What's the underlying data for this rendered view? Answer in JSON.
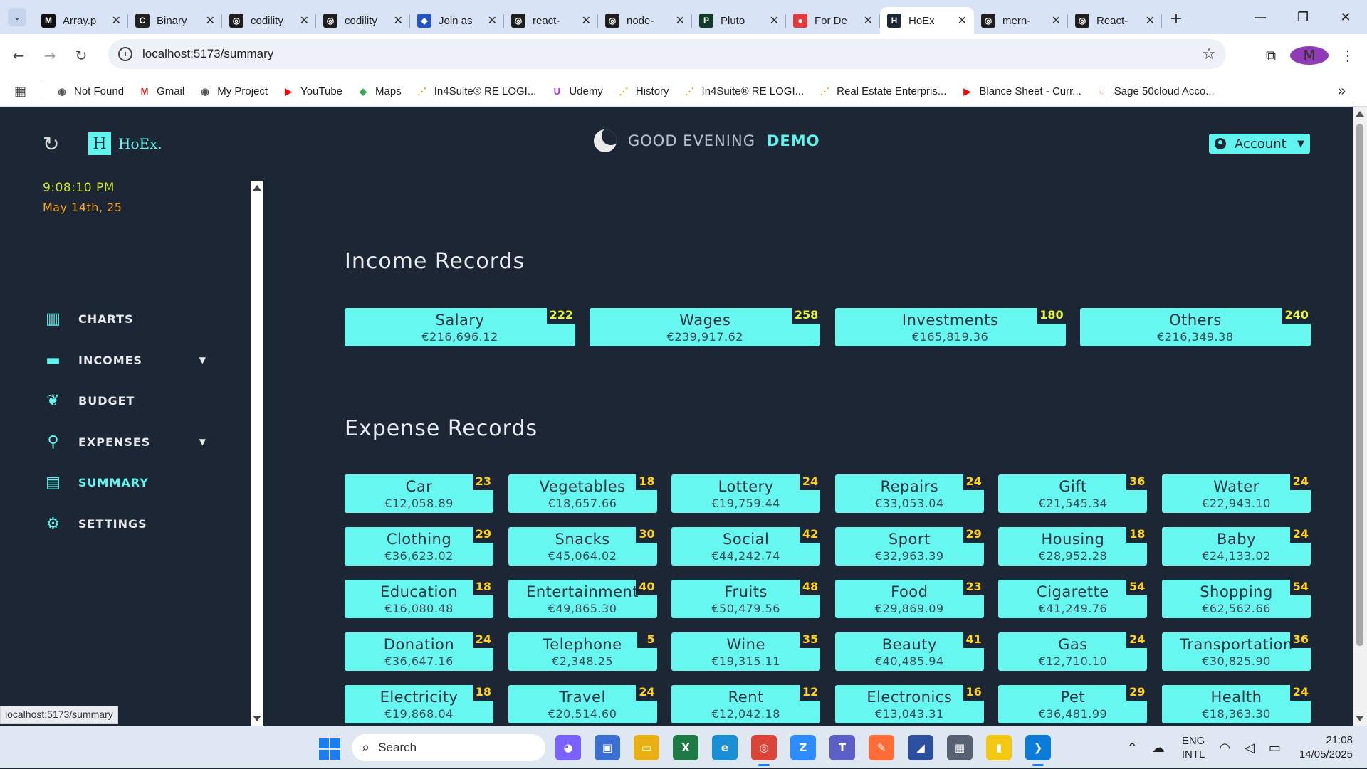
{
  "browser": {
    "tabs": [
      {
        "title": "Array.p",
        "fav": "M",
        "fav_color": "#111111"
      },
      {
        "title": "Binary",
        "fav": "C",
        "fav_color": "#222222"
      },
      {
        "title": "codility",
        "fav": "◎",
        "fav_color": "#1f1f1f"
      },
      {
        "title": "codility",
        "fav": "◎",
        "fav_color": "#1f1f1f"
      },
      {
        "title": "Join as",
        "fav": "◆",
        "fav_color": "#2554c7"
      },
      {
        "title": "react-",
        "fav": "◎",
        "fav_color": "#1f1f1f"
      },
      {
        "title": "node-",
        "fav": "◎",
        "fav_color": "#1f1f1f"
      },
      {
        "title": "Pluto",
        "fav": "P",
        "fav_color": "#0e3b2a"
      },
      {
        "title": "For De",
        "fav": "●",
        "fav_color": "#e23b3b"
      },
      {
        "title": "HoEx",
        "fav": "H",
        "fav_color": "#1d2634",
        "active": true
      },
      {
        "title": "mern-",
        "fav": "◎",
        "fav_color": "#1f1f1f"
      },
      {
        "title": "React-",
        "fav": "◎",
        "fav_color": "#1f1f1f"
      }
    ],
    "url": "localhost:5173/summary",
    "profile_initial": "M",
    "bookmarks": [
      {
        "label": "Not Found",
        "icon": "globe-icon",
        "glyph": "◉",
        "color": "#555555"
      },
      {
        "label": "Gmail",
        "icon": "gmail-icon",
        "glyph": "M",
        "color": "#d93025"
      },
      {
        "label": "My Project",
        "icon": "globe-icon",
        "glyph": "◉",
        "color": "#555555"
      },
      {
        "label": "YouTube",
        "icon": "youtube-icon",
        "glyph": "▶",
        "color": "#ff0000"
      },
      {
        "label": "Maps",
        "icon": "maps-icon",
        "glyph": "◆",
        "color": "#34a853"
      },
      {
        "label": "In4Suite® RE LOGI...",
        "icon": "in4suite-icon",
        "glyph": "⋰",
        "color": "#f29900"
      },
      {
        "label": "Udemy",
        "icon": "udemy-icon",
        "glyph": "U",
        "color": "#a435f0"
      },
      {
        "label": "History",
        "icon": "in4suite-icon",
        "glyph": "⋰",
        "color": "#f29900"
      },
      {
        "label": "In4Suite® RE LOGI...",
        "icon": "in4suite-icon",
        "glyph": "⋰",
        "color": "#f29900"
      },
      {
        "label": "Real Estate Enterpris...",
        "icon": "in4suite-icon",
        "glyph": "⋰",
        "color": "#f29900"
      },
      {
        "label": "Blance Sheet - Curr...",
        "icon": "youtube-icon",
        "glyph": "▶",
        "color": "#ff0000"
      },
      {
        "label": "Sage 50cloud Acco...",
        "icon": "sage-icon",
        "glyph": "◌",
        "color": "#e8541f"
      }
    ],
    "status_url": "localhost:5173/summary"
  },
  "app": {
    "logo_mark": "H",
    "logo_text": "HoEx.",
    "greeting": "GOOD EVENING",
    "user": "DEMO",
    "account_label": "Account",
    "time": "9:08:10  PM",
    "date": "May 14th, 25",
    "nav": [
      {
        "label": "CHARTS",
        "icon": "chart-icon",
        "glyph": "▥",
        "expandable": false,
        "active": false
      },
      {
        "label": "INCOMES",
        "icon": "money-icon",
        "glyph": "▬",
        "expandable": true,
        "active": false
      },
      {
        "label": "BUDGET",
        "icon": "budget-icon",
        "glyph": "❦",
        "expandable": false,
        "active": false
      },
      {
        "label": "EXPENSES",
        "icon": "expenses-icon",
        "glyph": "⚲",
        "expandable": true,
        "active": false
      },
      {
        "label": "SUMMARY",
        "icon": "summary-icon",
        "glyph": "▤",
        "expandable": false,
        "active": true
      },
      {
        "label": "SETTINGS",
        "icon": "gear-icon",
        "glyph": "⚙",
        "expandable": false,
        "active": false
      }
    ],
    "income_title": "Income Records",
    "expense_title": "Expense Records",
    "incomes": [
      {
        "name": "Salary",
        "amount": "€216,696.12",
        "count": "222"
      },
      {
        "name": "Wages",
        "amount": "€239,917.62",
        "count": "258"
      },
      {
        "name": "Investments",
        "amount": "€165,819.36",
        "count": "180"
      },
      {
        "name": "Others",
        "amount": "€216,349.38",
        "count": "240"
      }
    ],
    "expenses": [
      {
        "name": "Car",
        "amount": "€12,058.89",
        "count": "23"
      },
      {
        "name": "Vegetables",
        "amount": "€18,657.66",
        "count": "18"
      },
      {
        "name": "Lottery",
        "amount": "€19,759.44",
        "count": "24"
      },
      {
        "name": "Repairs",
        "amount": "€33,053.04",
        "count": "24"
      },
      {
        "name": "Gift",
        "amount": "€21,545.34",
        "count": "36"
      },
      {
        "name": "Water",
        "amount": "€22,943.10",
        "count": "24"
      },
      {
        "name": "Clothing",
        "amount": "€36,623.02",
        "count": "29"
      },
      {
        "name": "Snacks",
        "amount": "€45,064.02",
        "count": "30"
      },
      {
        "name": "Social",
        "amount": "€44,242.74",
        "count": "42"
      },
      {
        "name": "Sport",
        "amount": "€32,963.39",
        "count": "29"
      },
      {
        "name": "Housing",
        "amount": "€28,952.28",
        "count": "18"
      },
      {
        "name": "Baby",
        "amount": "€24,133.02",
        "count": "24"
      },
      {
        "name": "Education",
        "amount": "€16,080.48",
        "count": "18"
      },
      {
        "name": "Entertainment",
        "amount": "€49,865.30",
        "count": "40"
      },
      {
        "name": "Fruits",
        "amount": "€50,479.56",
        "count": "48"
      },
      {
        "name": "Food",
        "amount": "€29,869.09",
        "count": "23"
      },
      {
        "name": "Cigarette",
        "amount": "€41,249.76",
        "count": "54"
      },
      {
        "name": "Shopping",
        "amount": "€62,562.66",
        "count": "54"
      },
      {
        "name": "Donation",
        "amount": "€36,647.16",
        "count": "24"
      },
      {
        "name": "Telephone",
        "amount": "€2,348.25",
        "count": "5"
      },
      {
        "name": "Wine",
        "amount": "€19,315.11",
        "count": "35"
      },
      {
        "name": "Beauty",
        "amount": "€40,485.94",
        "count": "41"
      },
      {
        "name": "Gas",
        "amount": "€12,710.10",
        "count": "24"
      },
      {
        "name": "Transportation",
        "amount": "€30,825.90",
        "count": "36"
      },
      {
        "name": "Electricity",
        "amount": "€19,868.04",
        "count": "18"
      },
      {
        "name": "Travel",
        "amount": "€20,514.60",
        "count": "24"
      },
      {
        "name": "Rent",
        "amount": "€12,042.18",
        "count": "12"
      },
      {
        "name": "Electronics",
        "amount": "€13,043.31",
        "count": "16"
      },
      {
        "name": "Pet",
        "amount": "€36,481.99",
        "count": "29"
      },
      {
        "name": "Health",
        "amount": "€18,363.30",
        "count": "24"
      }
    ]
  },
  "taskbar": {
    "search_placeholder": "Search",
    "apps": [
      {
        "name": "copilot-icon",
        "glyph": "◕",
        "color": "#7b61ff"
      },
      {
        "name": "desktop-icon",
        "glyph": "▣",
        "color": "#3b6fd1"
      },
      {
        "name": "file-explorer-icon",
        "glyph": "▭",
        "color": "#e8b012"
      },
      {
        "name": "excel-icon",
        "glyph": "X",
        "color": "#1d7a45"
      },
      {
        "name": "edge-icon",
        "glyph": "e",
        "color": "#1a8fd6"
      },
      {
        "name": "chrome-icon",
        "glyph": "◎",
        "color": "#db4437",
        "open": true
      },
      {
        "name": "zoom-icon",
        "glyph": "Z",
        "color": "#2d8cff"
      },
      {
        "name": "teams-icon",
        "glyph": "T",
        "color": "#5b5fc7"
      },
      {
        "name": "postman-icon",
        "glyph": "✎",
        "color": "#ff6c37"
      },
      {
        "name": "app-icon",
        "glyph": "◢",
        "color": "#2e4e9e"
      },
      {
        "name": "calculator-icon",
        "glyph": "▦",
        "color": "#586172"
      },
      {
        "name": "powerbi-icon",
        "glyph": "▮",
        "color": "#f2c811"
      },
      {
        "name": "vscode-icon",
        "glyph": "❯",
        "color": "#0a7bd8",
        "open": true
      }
    ],
    "lang_top": "ENG",
    "lang_bottom": "INTL",
    "time": "21:08",
    "date": "14/05/2025"
  }
}
